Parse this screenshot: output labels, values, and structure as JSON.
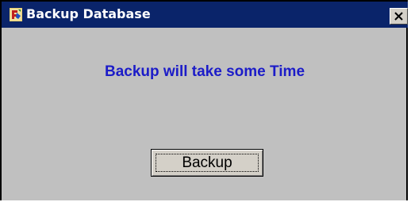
{
  "window": {
    "title": "Backup Database",
    "app_icon": "app-icon",
    "close_icon": "close-icon"
  },
  "dialog": {
    "message": "Backup will take some Time",
    "backup_button_label": "Backup"
  },
  "colors": {
    "titlebar": "#0a246a",
    "window_body": "#c0c0c0",
    "message_text": "#1c1cc8"
  }
}
